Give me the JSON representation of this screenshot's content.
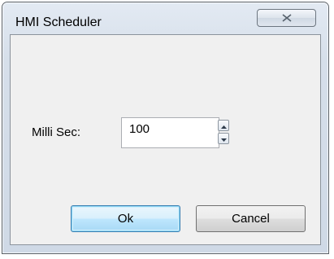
{
  "window": {
    "title": "HMI Scheduler"
  },
  "titlebar": {
    "close_icon": "close-x-icon"
  },
  "form": {
    "label": "Milli Sec:",
    "value": "100",
    "up_icon": "arrow-up-icon",
    "down_icon": "arrow-down-icon"
  },
  "buttons": {
    "ok_label": "Ok",
    "cancel_label": "Cancel"
  },
  "colors": {
    "ok_border": "#3c7fb1",
    "client_bg": "#f0f0f0"
  }
}
